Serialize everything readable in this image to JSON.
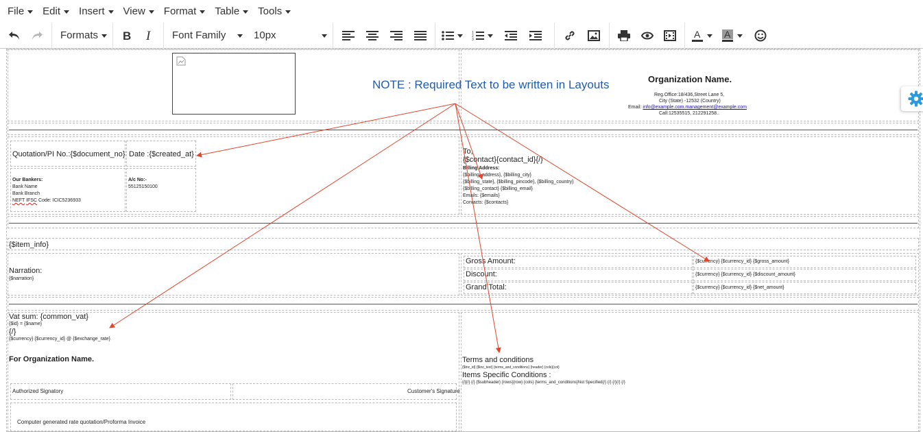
{
  "menubar": {
    "items": [
      "File",
      "Edit",
      "Insert",
      "View",
      "Format",
      "Table",
      "Tools"
    ]
  },
  "toolbar": {
    "formats_label": "Formats",
    "font_family_label": "Font Family",
    "font_size_label": "10px",
    "icons": [
      "undo-icon",
      "redo-icon",
      "bold-icon",
      "italic-icon",
      "align-left-icon",
      "align-center-icon",
      "align-right-icon",
      "align-justify-icon",
      "bullet-list-icon",
      "numbered-list-icon",
      "outdent-icon",
      "indent-icon",
      "link-icon",
      "image-icon",
      "print-icon",
      "preview-icon",
      "media-icon",
      "text-color-icon",
      "background-color-icon",
      "emoticons-icon"
    ]
  },
  "document": {
    "note": "NOTE : Required Text to be written in Layouts",
    "org": {
      "name": "Organization Name.",
      "line1": "Reg.Office:18/436,Street Lane 5,",
      "line2": "City (State) -12532 (Country)",
      "email_label": "Email: ",
      "email_link": "info@example.com.management@example.com",
      "call": "Call:12535515, 212291258.."
    },
    "quotation_no": "Quotation/PI No.:{$document_no}",
    "date": "Date :{$created_at}",
    "bankers": {
      "heading": "Our Bankers:",
      "name": "Bank Name",
      "branch": "Bank Branch",
      "neft_a": "NEFT",
      "ifsc": "IFSC",
      "code": " Code: ICIC5236933"
    },
    "account": {
      "label": "A/c No:-",
      "value": "55125150100"
    },
    "to": {
      "label": "To,",
      "contact": "{$contact}{contact_id}{/}",
      "billing_heading": "Billing Address:",
      "billing_l1": "{$billing_address}, {$billing_city}",
      "billing_l2": "{$billing_state}, {$billing_pincode}, {$billing_country}",
      "billing_l3": "{$billing_contact} {$billing_email}",
      "emails": "Emails: {$emails}",
      "contacts": "Contacts: {$contacts}"
    },
    "item_info": "{$item_info}",
    "narration_label": "Narration:",
    "narration_value": "{$narration}",
    "totals": [
      {
        "label": "Gross Amount:",
        "value": "{$currency} {$currency_id} {$gross_amount}"
      },
      {
        "label": "Discount:",
        "value": "{$currency} {$currency_id} {$discount_amount}"
      },
      {
        "label": "Grand Total:",
        "value": "{$currency} {$currency_id} {$net_amount}"
      }
    ],
    "vat_sum": "Vat sum: {common_vat}",
    "vat_item": "{$id} = {$name}",
    "vat_close": "{/}",
    "exchange": "{$currency} {$currency_id} @ {$exchange_rate}",
    "for_org": "For Organization Name.",
    "authorized": "Authorized Signatory",
    "customer_sig": "Customer's Signature",
    "footer_note": "Computer generated rate quotation/Proforma Invoice",
    "terms_heading": "Terms and conditions",
    "terms_line": "{$tnc_id} {$tnc_text} {terms_and_conditions} {header} {cols}{col}",
    "items_specific": "Items Specific Conditions :",
    "items_line": "{/}{/} {/} {$subheader} {rows}{row} {cols} {terms_and_conditions}Not Specified{/} {/} {/}{/} {/}"
  },
  "colors": {
    "note": "#1d5cb4",
    "arrow": "#e5442b",
    "link": "#1a0dab"
  }
}
